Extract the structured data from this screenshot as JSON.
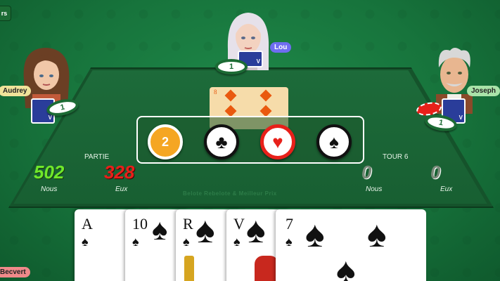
{
  "corner_badge": "rs",
  "players": {
    "top": {
      "name": "Lou",
      "chip": "1",
      "card_back": "V",
      "tag_color": "#6f6df0"
    },
    "left": {
      "name": "Audrey",
      "chip": "1",
      "card_back": "V",
      "tag_color": "#f0e39a"
    },
    "right": {
      "name": "Joseph",
      "chip": "1",
      "card_back": "V",
      "tag_color": "#a9e3a9"
    },
    "bottom": {
      "name": "Becvert",
      "tag_color": "#f08a8a"
    }
  },
  "trump_card": {
    "rank": "8",
    "suit": "diamond"
  },
  "bid_choices": [
    {
      "label": "2",
      "kind": "number",
      "color": "#f5a623"
    },
    {
      "label": "♣",
      "kind": "club",
      "color": "#111111"
    },
    {
      "label": "♥",
      "kind": "heart",
      "color": "#e8201a"
    },
    {
      "label": "♠",
      "kind": "spade",
      "color": "#111111"
    }
  ],
  "score": {
    "section_label": "PARTIE",
    "us_value": "502",
    "them_value": "328",
    "us_label": "Nous",
    "them_label": "Eux",
    "us_color": "#6fe82a",
    "them_color": "#e8201a"
  },
  "round": {
    "section_label": "TOUR 6",
    "us_value": "0",
    "them_value": "0",
    "us_label": "Nous",
    "them_label": "Eux"
  },
  "table_caption": "Belote Rebelote & Meilleur Prix",
  "hand": [
    {
      "rank": "A",
      "suit": "♠"
    },
    {
      "rank": "10",
      "suit": "♠"
    },
    {
      "rank": "R",
      "suit": "♠"
    },
    {
      "rank": "V",
      "suit": "♠"
    },
    {
      "rank": "7",
      "suit": "♠"
    }
  ]
}
